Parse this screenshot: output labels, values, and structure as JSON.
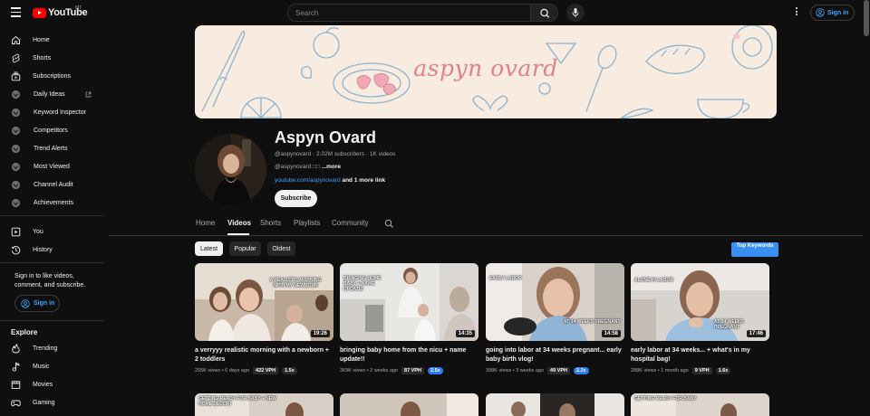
{
  "topbar": {
    "logo_text": "YouTube",
    "logo_region": "MT",
    "search_placeholder": "Search",
    "signin_label": "Sign in"
  },
  "sidebar": {
    "primary": [
      {
        "label": "Home",
        "icon": "home-icon"
      },
      {
        "label": "Shorts",
        "icon": "shorts-icon"
      },
      {
        "label": "Subscriptions",
        "icon": "subscriptions-icon"
      }
    ],
    "extension_items": [
      {
        "label": "Daily Ideas",
        "icon": "vidiq-icon"
      },
      {
        "label": "Keyword Inspector",
        "icon": "vidiq-icon"
      },
      {
        "label": "Competitors",
        "icon": "vidiq-icon"
      },
      {
        "label": "Trend Alerts",
        "icon": "vidiq-icon"
      },
      {
        "label": "Most Viewed",
        "icon": "vidiq-icon"
      },
      {
        "label": "Channel Audit",
        "icon": "vidiq-icon"
      },
      {
        "label": "Achievements",
        "icon": "vidiq-icon"
      }
    ],
    "you_items": [
      {
        "label": "You",
        "icon": "you-icon"
      },
      {
        "label": "History",
        "icon": "history-icon"
      }
    ],
    "signin_prompt": "Sign in to like videos, comment, and subscribe.",
    "signin_label": "Sign in",
    "explore_heading": "Explore",
    "explore_items": [
      {
        "label": "Trending",
        "icon": "trending-icon"
      },
      {
        "label": "Music",
        "icon": "music-icon"
      },
      {
        "label": "Movies",
        "icon": "movies-icon"
      },
      {
        "label": "Gaming",
        "icon": "gaming-icon"
      }
    ]
  },
  "channel": {
    "banner_text": "aspyn ovard",
    "name": "Aspyn Ovard",
    "handle": "@aspynovard",
    "subscribers": "2.02M subscribers",
    "videos": "1K videos",
    "description": "@aspynovard □□",
    "description_more": "...more",
    "link_url": "youtube.com/aspynovard",
    "link_more": "and 1 more link",
    "subscribe_label": "Subscribe"
  },
  "tabs": [
    {
      "label": "Home",
      "active": false
    },
    {
      "label": "Videos",
      "active": true
    },
    {
      "label": "Shorts",
      "active": false
    },
    {
      "label": "Playlists",
      "active": false
    },
    {
      "label": "Community",
      "active": false
    }
  ],
  "chips": [
    {
      "label": "Latest",
      "active": true
    },
    {
      "label": "Popular",
      "active": false
    },
    {
      "label": "Oldest",
      "active": false
    }
  ],
  "top_keywords_label": "Top Keywords",
  "colors": {
    "background": "#0f0f0f",
    "accent_link": "#3ea6ff",
    "youtube_red": "#ff0000",
    "banner_bg": "#f7ecdf",
    "banner_text": "#e07f93",
    "multiplier_badge_blue": "#2e7bf6",
    "top_keywords_blue": "#3a8ff5"
  },
  "videos": [
    {
      "title": "a verryyy realistic morning with a newborn + 2 toddlers",
      "duration": "19:26",
      "views": "205K views",
      "age": "6 days ago",
      "vph": "422 VPH",
      "multiplier": "1.5x",
      "multiplier_highlight": false,
      "overlay": "A REALISTIC MORNING WITH MY NEWBORN"
    },
    {
      "title": "bringing baby home from the nicu + name update!!",
      "duration": "14:35",
      "views": "369K views",
      "age": "2 weeks ago",
      "vph": "87 VPH",
      "multiplier": "2.5x",
      "multiplier_highlight": true,
      "overlay": "BRINGING HOME BABY + NAME UPDATE!"
    },
    {
      "title": "going into labor at 34 weeks pregnant... early baby birth vlog!",
      "duration": "14:58",
      "views": "398K views",
      "age": "3 weeks ago",
      "vph": "49 VPH",
      "multiplier": "2.2x",
      "multiplier_highlight": true,
      "overlay": "AT 34 WEEKS PREGNANT",
      "overlay_top": "EARLY LABOR"
    },
    {
      "title": "early labor at 34 weeks... + what's in my hospital bag!",
      "duration": "17:46",
      "views": "288K views",
      "age": "1 month ago",
      "vph": "9 VPH",
      "multiplier": "1.6x",
      "multiplier_highlight": false,
      "overlay": "AT 34 WEEKS PREGNANT",
      "overlay_top": "ALONE IN LABOR"
    }
  ],
  "row2_overlays": [
    "GETTING READY FOR BABY + NEW HOME DECOR!",
    "",
    "",
    "GETTING READY FOR BABY"
  ]
}
